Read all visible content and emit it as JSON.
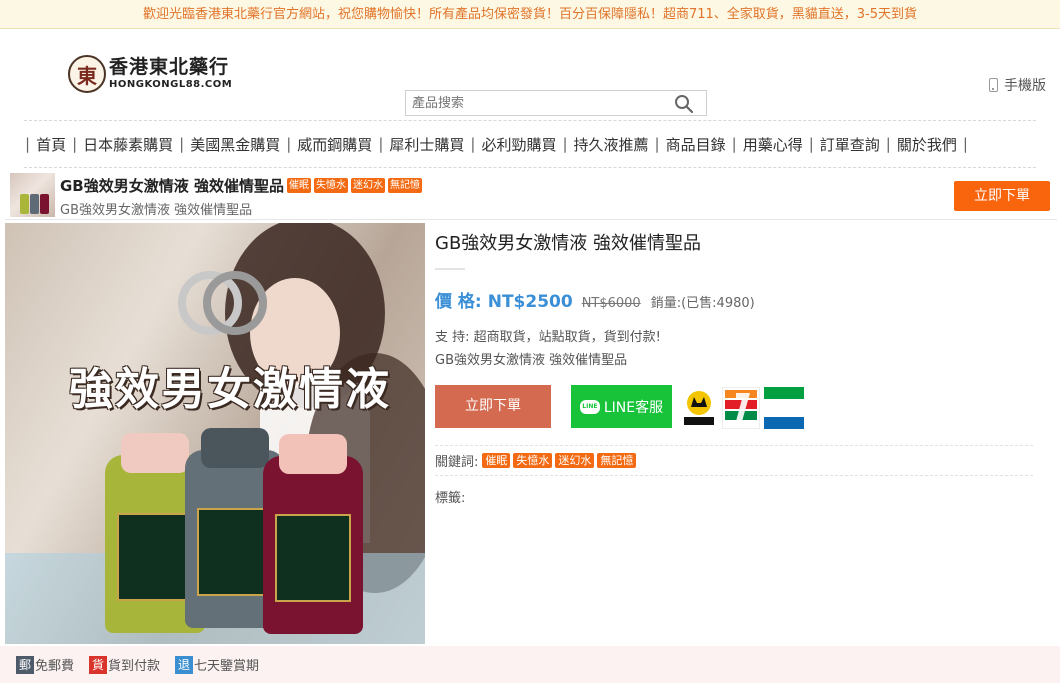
{
  "topbar": {
    "announcement": "歡迎光臨香港東北藥行官方網站，祝您購物愉快！所有產品均保密發貨！百分百保障隱私！超商711、全家取貨，黑貓直送，3-5天到貨"
  },
  "header": {
    "logo_mark": "東",
    "logo_cn": "香港東北藥行",
    "logo_en": "HONGKONGL88.COM",
    "search_placeholder": "產品搜索",
    "mobile_label": "手機版"
  },
  "nav": {
    "items": [
      {
        "label": "首頁"
      },
      {
        "label": "日本藤素購買"
      },
      {
        "label": "美國黑金購買"
      },
      {
        "label": "威而鋼購買"
      },
      {
        "label": "犀利士購買"
      },
      {
        "label": "必利勁購買"
      },
      {
        "label": "持久液推薦"
      },
      {
        "label": "商品目錄"
      },
      {
        "label": "用藥心得"
      },
      {
        "label": "訂單查詢"
      },
      {
        "label": "關於我們"
      }
    ],
    "separator": "|"
  },
  "product_bar": {
    "title": "GB強效男女激情液 強效催情聖品",
    "tags": [
      "催眠",
      "失憶水",
      "迷幻水",
      "無記憶"
    ],
    "subtitle": "GB強效男女激情液 強效催情聖品",
    "order_label": "立即下單"
  },
  "product": {
    "image_caption": "強效男女激情液",
    "title": "GB強效男女激情液 強效催情聖品",
    "price_label": "價 格:",
    "price": "NT$2500",
    "original_price": "NT$6000",
    "sales": "銷量:(已售:4980)",
    "support": "支  持:   超商取貨，站點取貨，貨到付款!",
    "description": "GB強效男女激情液 強效催情聖品",
    "order_label": "立即下單",
    "line_label": "LINE客服",
    "line_icon_text": "LINE",
    "shipping_logos": [
      "black-cat-logo",
      "seven-eleven-logo",
      "familymart-logo"
    ],
    "keywords_label": "關鍵詞:",
    "keywords": [
      "催眠",
      "失憶水",
      "迷幻水",
      "無記憶"
    ],
    "tags_label": "標籤:"
  },
  "footer_badges": [
    {
      "icon": "郵",
      "label": "免郵費",
      "color": "#4d5a6a"
    },
    {
      "icon": "貨",
      "label": "貨到付款",
      "color": "#d9342b"
    },
    {
      "icon": "退",
      "label": "七天鑒賞期",
      "color": "#3b8fd0"
    }
  ],
  "colors": {
    "accent_orange": "#f8650d",
    "price_blue": "#3a8fd6",
    "line_green": "#18c33a",
    "order_brick": "#d46a4f"
  }
}
